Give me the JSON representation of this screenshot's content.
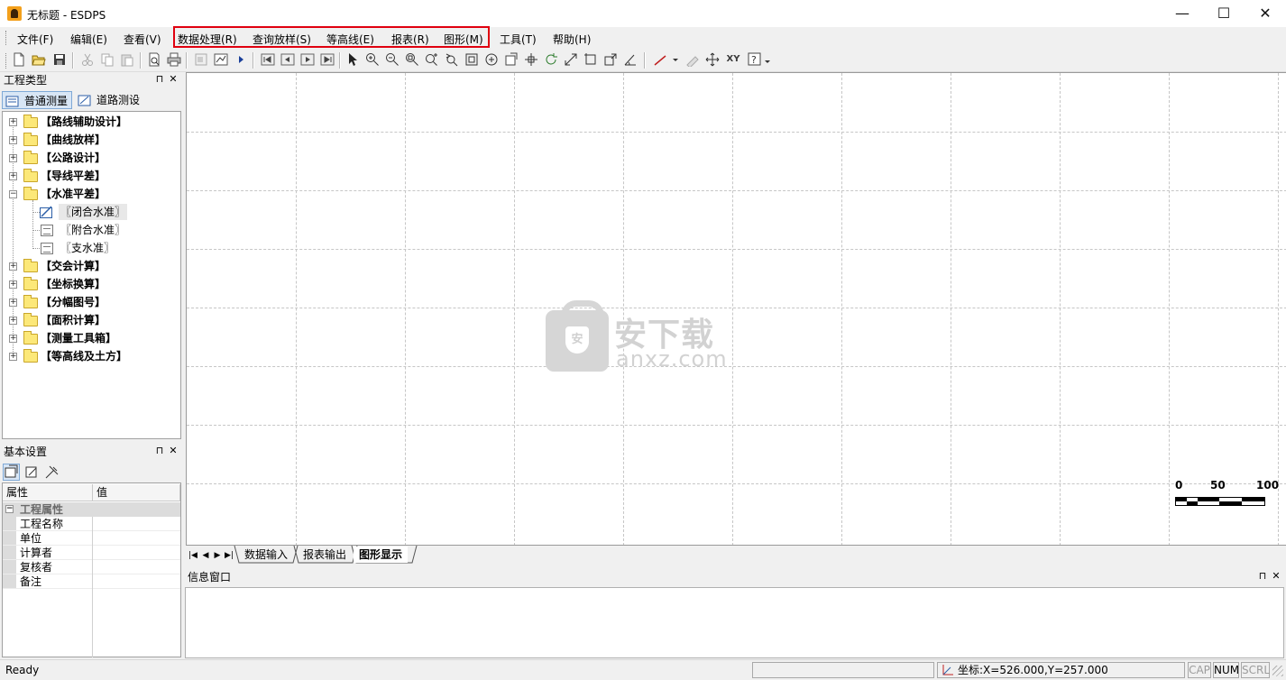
{
  "window": {
    "title": "无标题 - ESDPS",
    "controls": {
      "minimize": "—",
      "maximize": "☐",
      "close": "✕"
    }
  },
  "menu": [
    "文件(F)",
    "编辑(E)",
    "查看(V)",
    "数据处理(R)",
    "查询放样(S)",
    "等高线(E)",
    "报表(R)",
    "图形(M)",
    "工具(T)",
    "帮助(H)"
  ],
  "highlight_color": "#e0000f",
  "toolbar": {
    "icons": [
      "new-file-icon",
      "open-folder-icon",
      "save-icon",
      "cut-icon",
      "copy-icon",
      "paste-icon",
      "print-preview-icon",
      "print-icon",
      "image-icon",
      "chart-icon",
      "play-icon",
      "first-record-icon",
      "prev-record-icon",
      "next-record-icon",
      "last-record-icon",
      "pointer-icon",
      "zoom-in-icon",
      "zoom-out-icon",
      "zoom-window-icon",
      "zoom-extent-icon",
      "zoom-previous-icon",
      "zoom-all-icon",
      "pan-view-icon",
      "properties-icon",
      "move-icon",
      "rotate-icon",
      "redraw-icon",
      "fit-icon",
      "stretch-icon",
      "angle-icon",
      "line-tool-icon",
      "draw-disabled-icon",
      "pan-cross-icon",
      "xy-coordinate-icon",
      "help-icon"
    ],
    "xy_label": "XY"
  },
  "project_panel": {
    "title": "工程类型",
    "tabs": [
      "普通测量",
      "道路测设"
    ],
    "tree": [
      {
        "label": "【路线辅助设计】",
        "expanded": false
      },
      {
        "label": "【曲线放样】",
        "expanded": false
      },
      {
        "label": "【公路设计】",
        "expanded": false
      },
      {
        "label": "【导线平差】",
        "expanded": false
      },
      {
        "label": "【水准平差】",
        "expanded": true,
        "children": [
          "〖闭合水准〗",
          "〖附合水准〗",
          "〖支水准〗"
        ]
      },
      {
        "label": "【交会计算】",
        "expanded": false
      },
      {
        "label": "【坐标换算】",
        "expanded": false
      },
      {
        "label": "【分幅图号】",
        "expanded": false
      },
      {
        "label": "【面积计算】",
        "expanded": false
      },
      {
        "label": "【测量工具箱】",
        "expanded": false
      },
      {
        "label": "【等高线及土方】",
        "expanded": false
      }
    ]
  },
  "settings_panel": {
    "title": "基本设置",
    "headers": [
      "属性",
      "值"
    ],
    "category": "工程属性",
    "rows": [
      "工程名称",
      "单位",
      "计算者",
      "复核者",
      "备注"
    ]
  },
  "watermark": {
    "cn": "安下载",
    "en": "anxz.com",
    "badge": "安"
  },
  "scale_bar": {
    "labels": [
      "0",
      "50",
      "100"
    ]
  },
  "sheet_tabs": {
    "nav": [
      "|◀",
      "◀",
      "▶",
      "▶|"
    ],
    "tabs": [
      "数据输入",
      "报表输出",
      "图形显示"
    ],
    "active": 2
  },
  "info_panel": {
    "title": "信息窗口"
  },
  "panel_icons": {
    "pin": "⊓",
    "close": "✕",
    "expand": "+",
    "collapse": "−"
  },
  "status": {
    "ready": "Ready",
    "coords": "坐标:X=526.000,Y=257.000",
    "cap": "CAP",
    "num": "NUM",
    "scrl": "SCRL"
  }
}
